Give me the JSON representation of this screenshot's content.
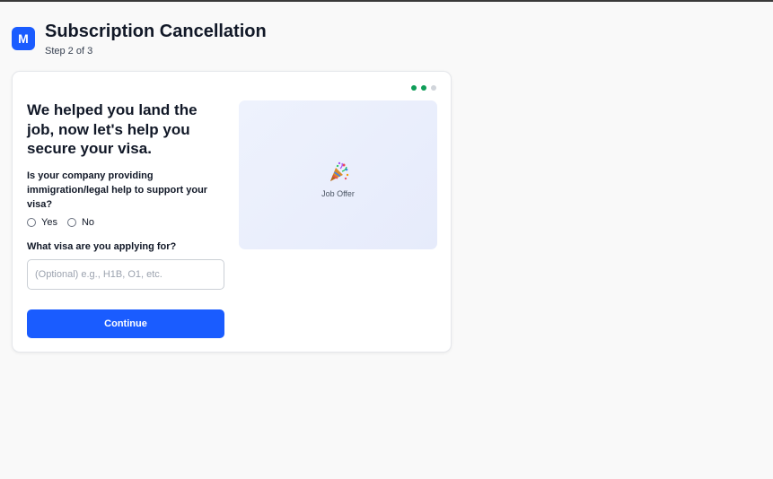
{
  "header": {
    "logo_letter": "M",
    "title": "Subscription Cancellation",
    "step": "Step 2 of 3"
  },
  "progress": {
    "current_step": 2,
    "total_steps": 3
  },
  "form": {
    "headline": "We helped you land the job, now let's help you secure your visa.",
    "question_support": "Is your company providing immigration/legal help to support your visa?",
    "radio_options": [
      "Yes",
      "No"
    ],
    "question_visa": "What visa are you applying for?",
    "visa_input_value": "",
    "visa_input_placeholder": "(Optional) e.g., H1B, O1, etc.",
    "continue_label": "Continue"
  },
  "preview": {
    "icon": "party-popper-icon",
    "label": "Job Offer"
  },
  "colors": {
    "accent": "#1a5cff",
    "progress_active": "#0f9d58",
    "progress_inactive": "#d1d5db"
  }
}
